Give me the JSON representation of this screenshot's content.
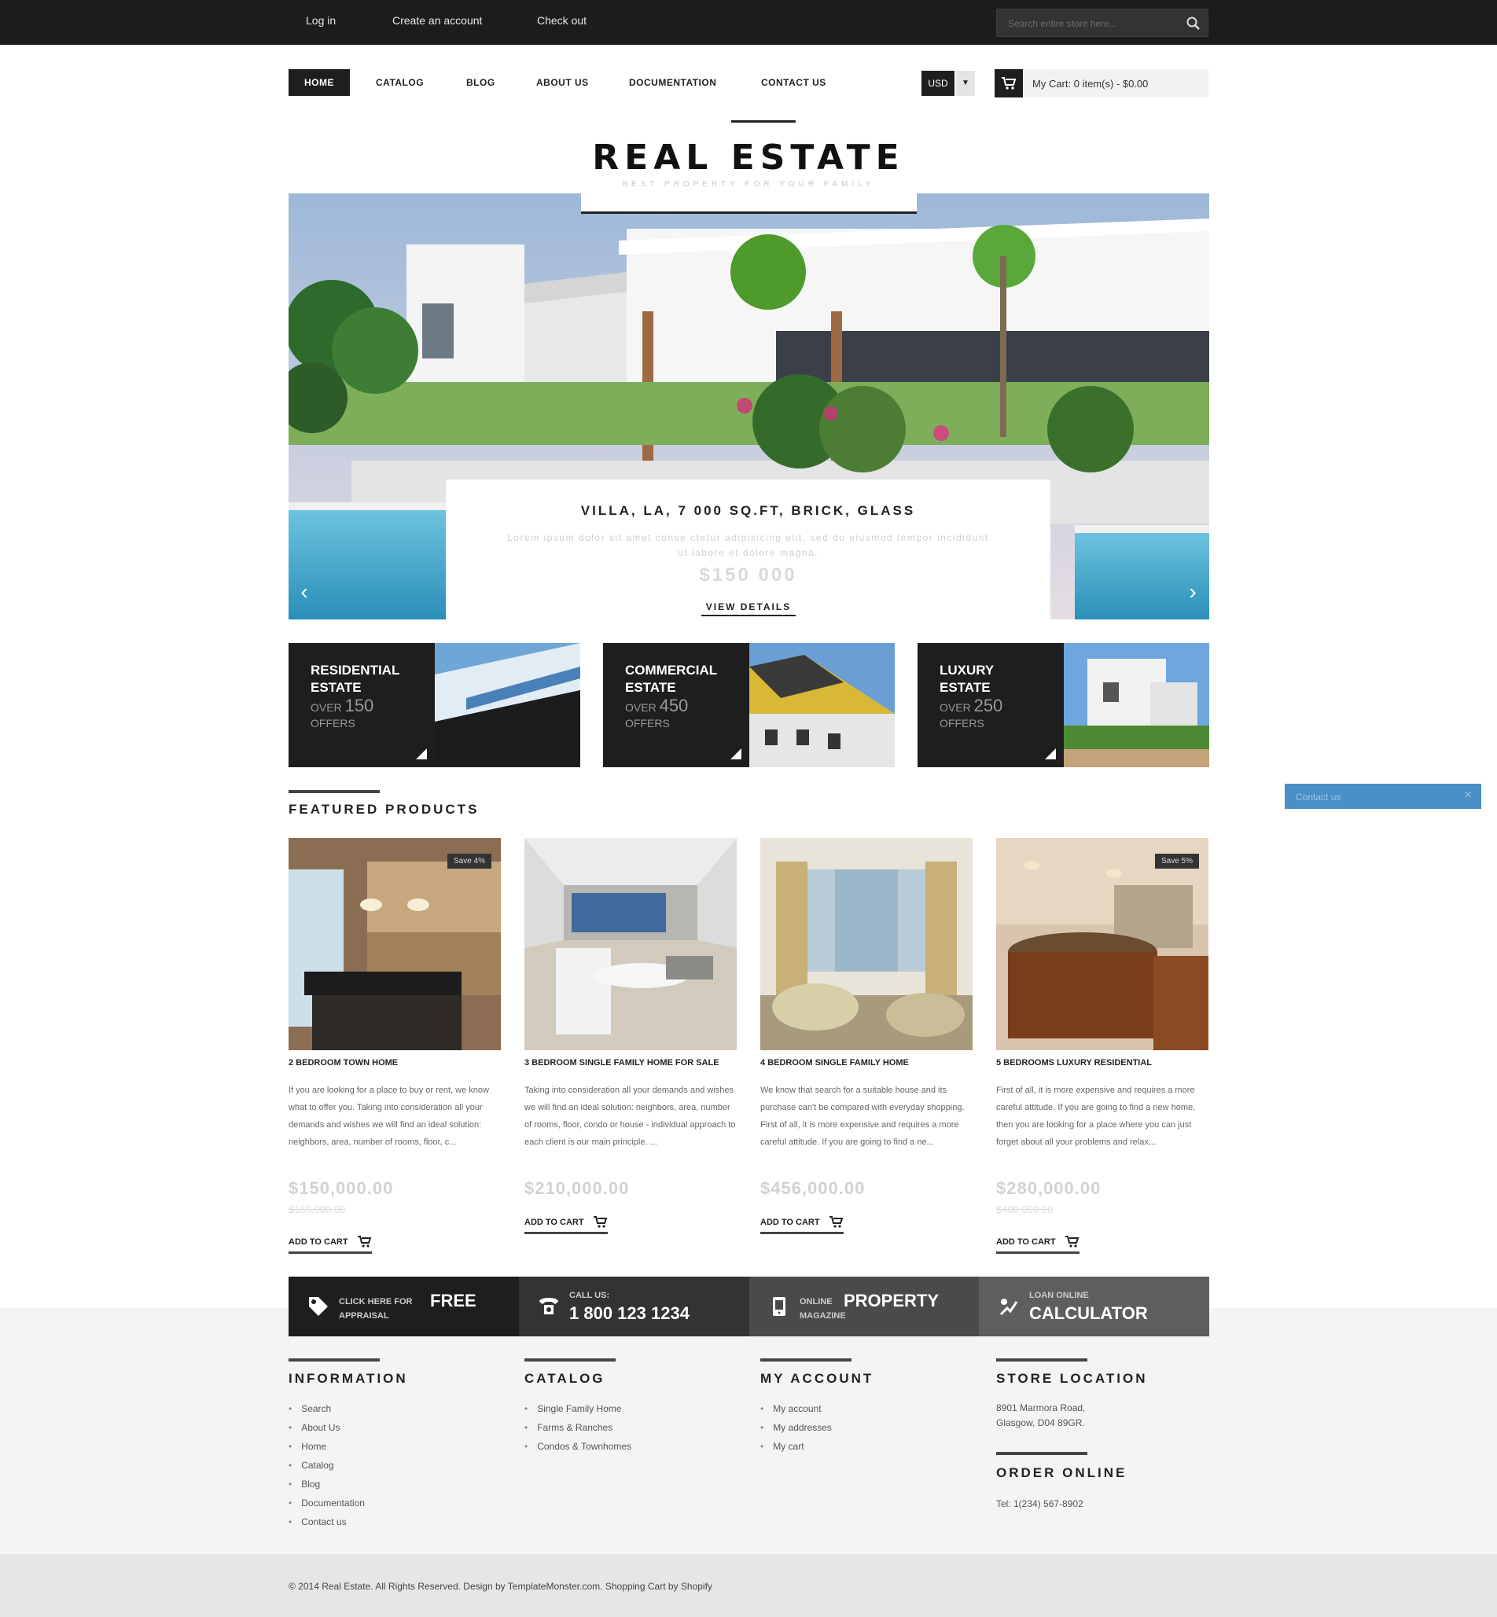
{
  "topbar": {
    "links": [
      "Log in",
      "Create an account",
      "Check out"
    ],
    "search_placeholder": "Search entire store here..."
  },
  "nav": {
    "items": [
      "HOME",
      "CATALOG",
      "BLOG",
      "ABOUT US",
      "DOCUMENTATION",
      "CONTACT US"
    ],
    "currency": "USD",
    "cart_text": "My Cart: 0 item(s) - $0.00"
  },
  "logo": {
    "title": "REAL ESTATE",
    "subtitle": "BEST PROPERTY FOR YOUR FAMILY"
  },
  "slider": {
    "caption_title": "VILLA, LA, 7 000 SQ.FT, BRICK, GLASS",
    "caption_desc": "Lorem ipsum dolor sit amet conse ctetur adipisicing elit, sed do eiusmod tempor incididunt ut labore et dolore magna.",
    "caption_price": "$150 000",
    "caption_link": "VIEW DETAILS"
  },
  "banners": [
    {
      "line1": "RESIDENTIAL",
      "line2": "ESTATE",
      "prefix": "OVER",
      "count": "150",
      "suffix": "OFFERS"
    },
    {
      "line1": "COMMERCIAL",
      "line2": "ESTATE",
      "prefix": "OVER",
      "count": "450",
      "suffix": "OFFERS"
    },
    {
      "line1": "LUXURY",
      "line2": "ESTATE",
      "prefix": "OVER",
      "count": "250",
      "suffix": "OFFERS"
    }
  ],
  "contact_tab": {
    "label": "Contact us",
    "close": "×"
  },
  "featured": {
    "title": "FEATURED PRODUCTS",
    "products": [
      {
        "badge": "Save 4%",
        "name": "2 BEDROOM TOWN HOME",
        "desc": "If you are looking for a place to buy or rent, we know what to offer you. Taking into consideration all your demands and wishes we will find an ideal solution: neighbors, area, number of rooms, floor, c...",
        "price": "$150,000.00",
        "old_price": "$160,000.00",
        "cart": "ADD TO CART"
      },
      {
        "badge": "",
        "name": "3 BEDROOM SINGLE FAMILY HOME FOR SALE",
        "desc": "Taking into consideration all your demands and wishes we will find an ideal solution: neighbors, area, number of rooms, floor, condo or house - individual approach to each client is our main principle. ...",
        "price": "$210,000.00",
        "old_price": "",
        "cart": "ADD TO CART"
      },
      {
        "badge": "",
        "name": "4 BEDROOM SINGLE FAMILY HOME",
        "desc": "We know that search for a suitable house and its purchase can't be compared with everyday shopping. First of all, it is more expensive and requires a more careful attitude. If you are going to find a ne...",
        "price": "$456,000.00",
        "old_price": "",
        "cart": "ADD TO CART"
      },
      {
        "badge": "Save 5%",
        "name": "5 BEDROOMS LUXURY RESIDENTIAL",
        "desc": "First of all, it is more expensive and requires a more careful attitude. If you are going to find a new home, then you are looking for a place where you can just forget about all your problems and relax...",
        "price": "$280,000.00",
        "old_price": "$400,000.00",
        "cart": "ADD TO CART"
      }
    ]
  },
  "strip": [
    {
      "small": "CLICK HERE FOR",
      "big": "FREE",
      "small2": "APPRAISAL"
    },
    {
      "small": "CALL US:",
      "big": "1 800 123 1234"
    },
    {
      "small": "ONLINE",
      "big": "PROPERTY",
      "small2": "MAGAZINE"
    },
    {
      "small": "LOAN ONLINE",
      "big": "CALCULATOR"
    }
  ],
  "footer": {
    "information": {
      "title": "INFORMATION",
      "items": [
        "Search",
        "About Us",
        "Home",
        "Catalog",
        "Blog",
        "Documentation",
        "Contact us"
      ]
    },
    "catalog": {
      "title": "CATALOG",
      "items": [
        "Single Family Home",
        "Farms & Ranches",
        "Condos & Townhomes"
      ]
    },
    "account": {
      "title": "MY ACCOUNT",
      "items": [
        "My account",
        "My addresses",
        "My cart"
      ]
    },
    "store": {
      "title": "STORE LOCATION",
      "address1": "8901 Marmora Road,",
      "address2": "Glasgow, D04 89GR."
    },
    "order": {
      "title": "ORDER ONLINE",
      "tel": "Tel: 1(234) 567-8902"
    }
  },
  "copyright": "© 2014 Real Estate. All Rights Reserved. Design by TemplateMonster.com. Shopping Cart by Shopify"
}
